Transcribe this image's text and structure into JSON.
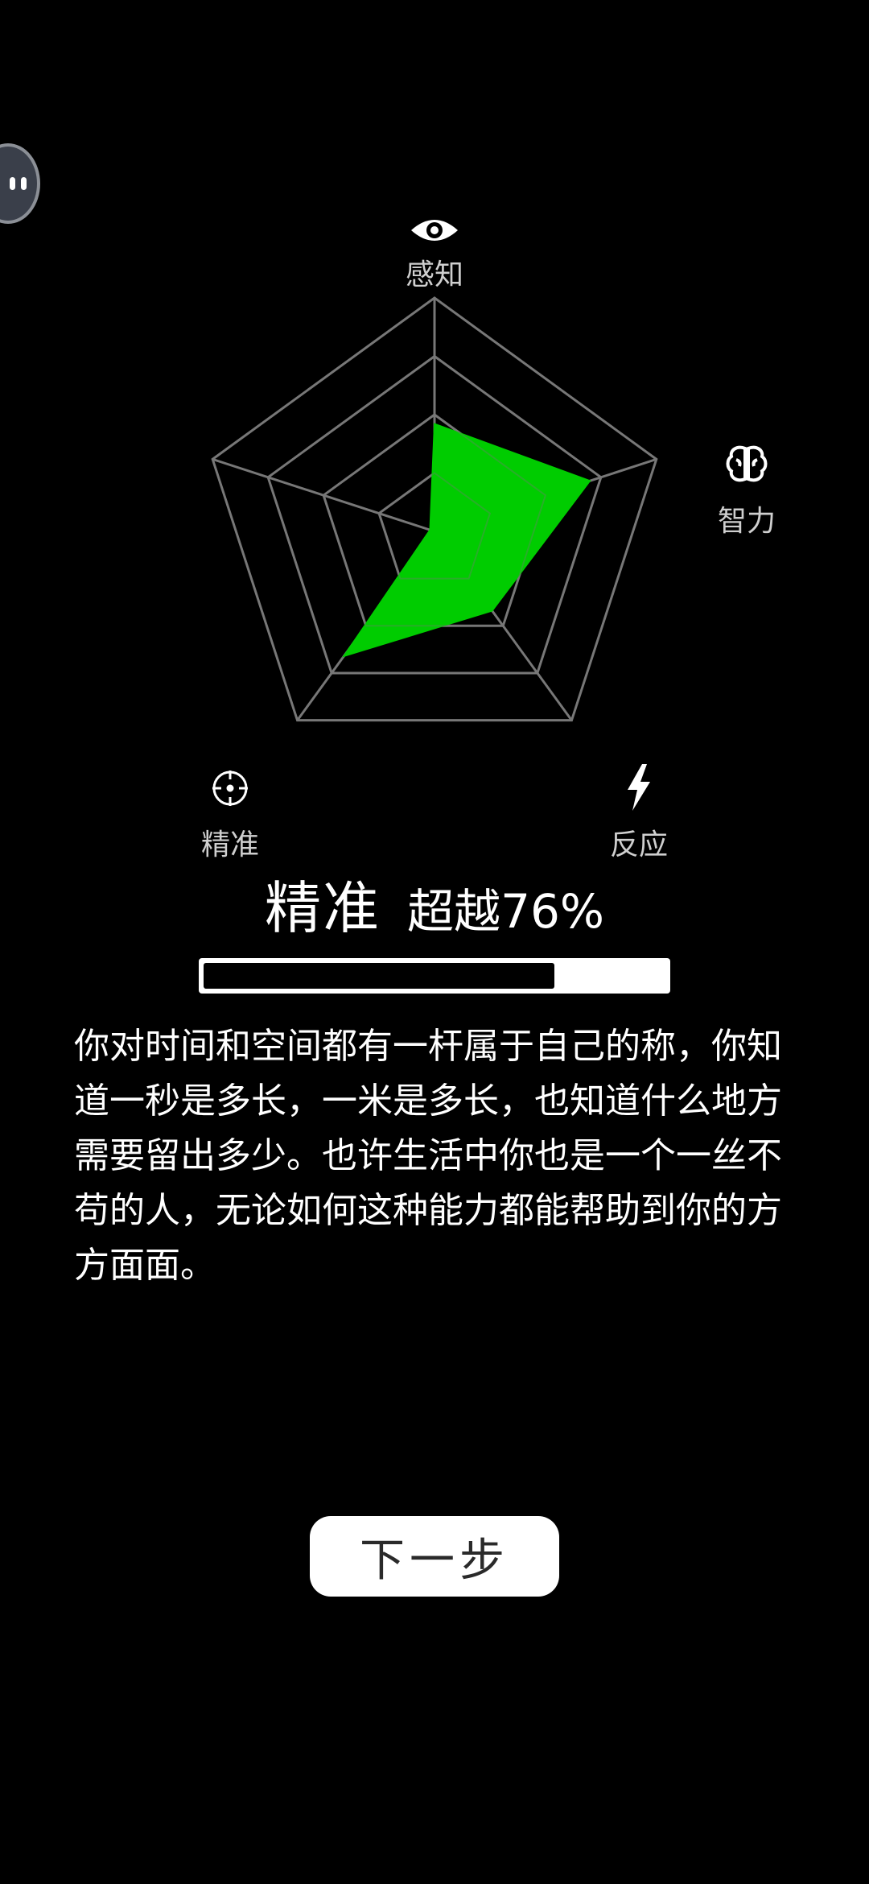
{
  "radar": {
    "dimensions": [
      {
        "key": "perception",
        "label": "感知",
        "icon": "eye-icon"
      },
      {
        "key": "intelligence",
        "label": "智力",
        "icon": "brain-icon"
      },
      {
        "key": "reaction",
        "label": "反应",
        "icon": "lightning-icon"
      },
      {
        "key": "precision",
        "label": "精准",
        "icon": "crosshair-icon"
      },
      {
        "key": "fifth",
        "label": "",
        "icon": ""
      }
    ],
    "rings": 4,
    "values": [
      0.46,
      0.7,
      0.42,
      0.66,
      0.02
    ],
    "fill_color": "#00cc00",
    "grid_color": "#777777"
  },
  "result": {
    "name": "精准",
    "percent_text": "超越76%",
    "progress": 0.76
  },
  "description": "你对时间和空间都有一杆属于自己的称，你知道一秒是多长，一米是多长，也知道什么地方需要留出多少。也许生活中你也是一个一丝不苟的人，无论如何这种能力都能帮助到你的方方面面。",
  "next_button_label": "下一步"
}
